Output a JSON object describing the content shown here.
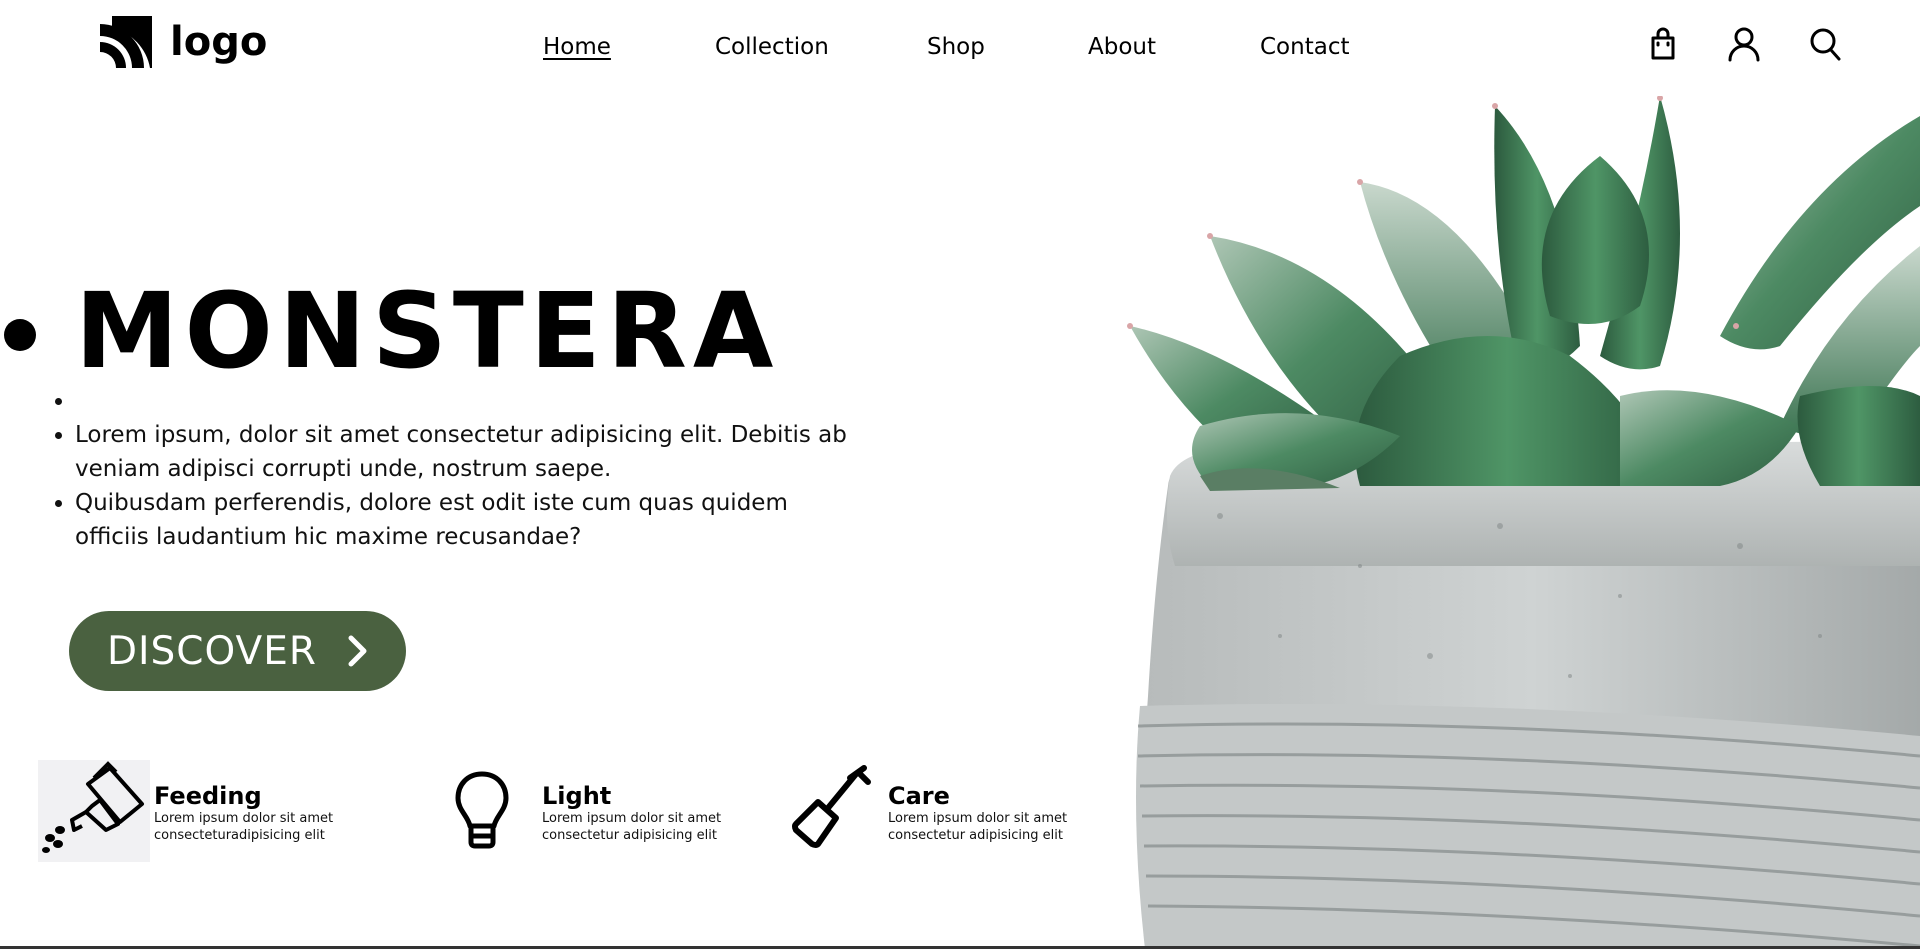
{
  "brand": {
    "logo_text": "logo"
  },
  "nav": {
    "items": [
      {
        "label": "Home",
        "active": true
      },
      {
        "label": "Collection",
        "active": false
      },
      {
        "label": "Shop",
        "active": false
      },
      {
        "label": "About",
        "active": false
      },
      {
        "label": "Contact",
        "active": false
      }
    ]
  },
  "header_icons": [
    "shopping-bag-icon",
    "user-icon",
    "search-icon"
  ],
  "hero": {
    "title": "MONSTERA",
    "paragraphs": [
      "Lorem ipsum, dolor sit amet consectetur adipisicing elit. Debitis ab veniam adipisci corrupti unde, nostrum saepe.",
      "Quibusdam perferendis, dolore est odit iste cum quas quidem officiis laudantium hic maxime recusandae?"
    ],
    "button_label": "DISCOVER"
  },
  "features": [
    {
      "title": "Feeding",
      "desc": "Lorem ipsum dolor sit amet consecteturadipisicing elit",
      "icon": "watering-can-icon"
    },
    {
      "title": "Light",
      "desc": "Lorem ipsum dolor sit amet consectetur adipisicing elit",
      "icon": "lightbulb-icon"
    },
    {
      "title": "Care",
      "desc": "Lorem ipsum dolor sit amet consectetur adipisicing elit",
      "icon": "shovel-icon"
    }
  ],
  "colors": {
    "accent": "#4a6140",
    "text": "#000000",
    "background": "#ffffff"
  }
}
